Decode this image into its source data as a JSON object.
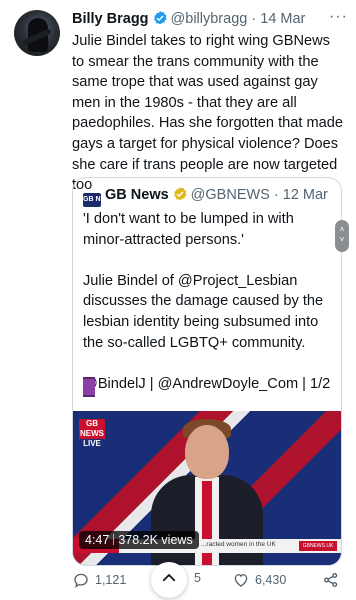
{
  "tweet": {
    "author_name": "Billy Bragg",
    "handle": "@billybragg",
    "separator": "·",
    "date": "14 Mar",
    "more_label": "···",
    "text": "Julie Bindel takes to right wing GBNews to smear the trans community with the same trope that was used against gay men in the 1980s - that they are all paedophiles. Has she forgotten that made gays a target for physical violence? Does she care if trans people are now targeted too"
  },
  "quote": {
    "logo_text": "GB NEWS",
    "author_name": "GB News",
    "handle": "@GBNEWS",
    "separator": "·",
    "date": "12 Mar",
    "text": "'I don't want to be lumped in with minor-attracted persons.'\n\nJulie Bindel of @Project_Lesbian discusses the damage caused by the lesbian identity being subsumed into the so-called LGBTQ+ community.\n\n@BindelJ | @AndrewDoyle_Com | 1/2",
    "video": {
      "channel_logo": "GB NEWS LIVE",
      "duration": "4:47",
      "views": "378.2K views",
      "ticker_text": "...racted women in the UK",
      "ticker_badge": "GBNEWS.UK"
    }
  },
  "actions": {
    "replies": "1,121",
    "retweets": "1",
    "retweets_tail": "5",
    "likes": "6,430"
  },
  "colors": {
    "verified_blue": "#1d9bf0",
    "verified_gold": "#e2b719",
    "secondary_text": "#536471"
  }
}
